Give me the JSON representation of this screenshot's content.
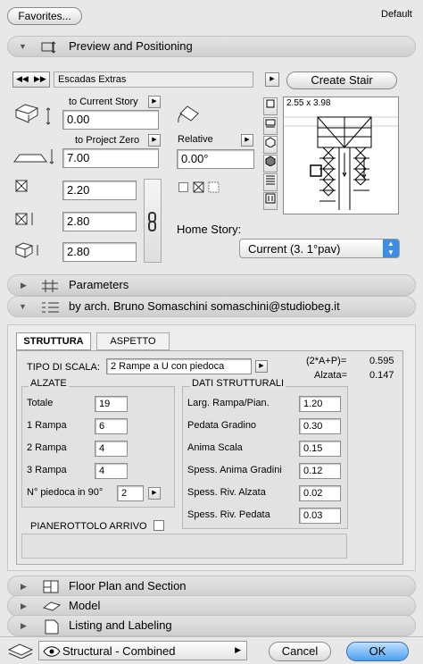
{
  "favorites_label": "Favorites...",
  "default_label": "Default",
  "sections": {
    "preview": "Preview and Positioning",
    "parameters": "Parameters",
    "author": "by arch. Bruno Somaschini somaschini@studiobeg.it",
    "floorplan": "Floor Plan and Section",
    "model": "Model",
    "listing": "Listing and Labeling"
  },
  "library": {
    "name": "Escadas Extras",
    "create_label": "Create Stair"
  },
  "positioning": {
    "to_current_story_label": "to Current Story",
    "to_current_story": "0.00",
    "to_project_zero_label": "to Project Zero",
    "to_project_zero": "7.00",
    "width": "2.20",
    "length": "2.80",
    "height": "2.80",
    "relative_label": "Relative",
    "angle": "0.00°",
    "home_story_label": "Home Story:",
    "home_story": "Current (3. 1°pav)"
  },
  "preview": {
    "size_label": "2.55 x 3.98"
  },
  "tabs": [
    "STRUTTURA",
    "ASPETTO"
  ],
  "tipo": {
    "label": "TIPO DI SCALA:",
    "value": "2 Rampe a U con piedoca"
  },
  "formula": {
    "a_label": "(2*A+P)=",
    "a_value": "0.595",
    "b_label": "Alzata=",
    "b_value": "0.147"
  },
  "alzate": {
    "title": "ALZATE",
    "rows": [
      {
        "label": "Totale",
        "value": "19"
      },
      {
        "label": "1 Rampa",
        "value": "6"
      },
      {
        "label": "2 Rampa",
        "value": "4"
      },
      {
        "label": "3 Rampa",
        "value": "4"
      }
    ],
    "piedoca_label": "N° piedoca in 90°",
    "piedoca_value": "2"
  },
  "dati": {
    "title": "DATI STRUTTURALI",
    "rows": [
      {
        "label": "Larg. Rampa/Pian.",
        "value": "1.20"
      },
      {
        "label": "Pedata Gradino",
        "value": "0.30"
      },
      {
        "label": "Anima Scala",
        "value": "0.15"
      },
      {
        "label": "Spess. Anima Gradini",
        "value": "0.12"
      },
      {
        "label": "Spess. Riv. Alzata",
        "value": "0.02"
      },
      {
        "label": "Spess. Riv. Pedata",
        "value": "0.03"
      }
    ]
  },
  "pianerottolo_label": "PIANEROTTOLO ARRIVO",
  "footer": {
    "view_label": "Structural - Combined",
    "cancel_label": "Cancel",
    "ok_label": "OK"
  },
  "colors": {
    "accent": "#3a8ee6"
  }
}
